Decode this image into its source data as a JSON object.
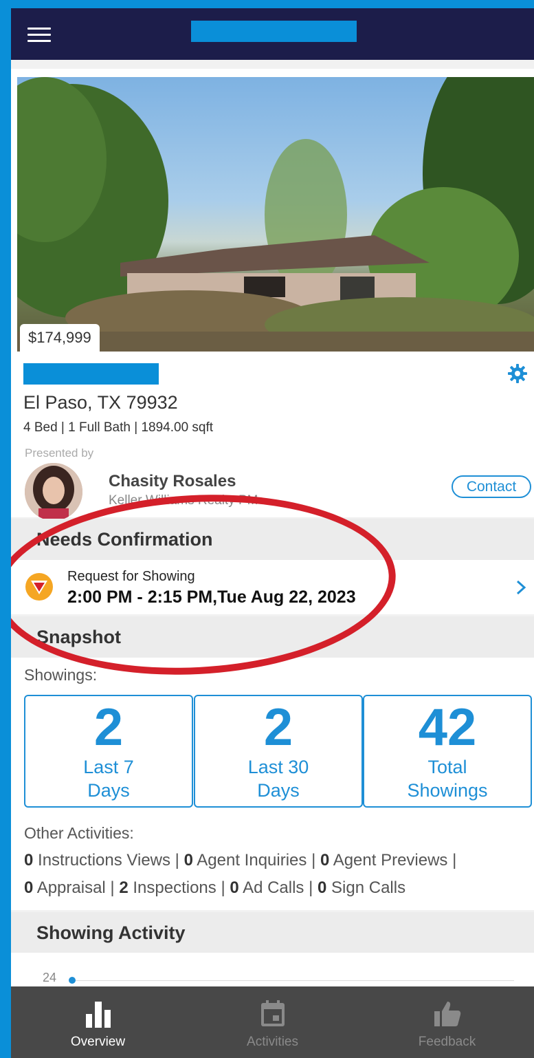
{
  "header": {
    "title_redacted": true
  },
  "listing": {
    "price": "$174,999",
    "address_redacted": true,
    "city": "El Paso, TX 79932",
    "specs": "4 Bed | 1 Full Bath | 1894.00 sqft",
    "presented_by": "Presented by",
    "agent_name": "Chasity Rosales",
    "agent_company": "Keller Williams Realty PM",
    "contact_label": "Contact"
  },
  "needs_confirmation": {
    "heading": "Needs Confirmation",
    "request_label": "Request for Showing",
    "request_time": "2:00 PM - 2:15 PM,Tue Aug 22, 2023"
  },
  "snapshot": {
    "heading": "Snapshot",
    "showings_label": "Showings:",
    "stats": [
      {
        "value": "2",
        "label_line1": "Last 7",
        "label_line2": "Days"
      },
      {
        "value": "2",
        "label_line1": "Last 30",
        "label_line2": "Days"
      },
      {
        "value": "42",
        "label_line1": "Total",
        "label_line2": "Showings"
      }
    ],
    "other_label": "Other Activities:",
    "other_activities": [
      {
        "count": "0",
        "name": "Instructions Views"
      },
      {
        "count": "0",
        "name": "Agent Inquiries"
      },
      {
        "count": "0",
        "name": "Agent Previews"
      },
      {
        "count": "0",
        "name": "Appraisal"
      },
      {
        "count": "2",
        "name": "Inspections"
      },
      {
        "count": "0",
        "name": "Ad Calls"
      },
      {
        "count": "0",
        "name": "Sign Calls"
      }
    ]
  },
  "showing_activity": {
    "heading": "Showing Activity",
    "y_tick": "24"
  },
  "bottom_nav": {
    "items": [
      {
        "label": "Overview",
        "icon": "bar-chart-icon",
        "active": true
      },
      {
        "label": "Activities",
        "icon": "calendar-icon",
        "active": false
      },
      {
        "label": "Feedback",
        "icon": "thumbs-up-icon",
        "active": false
      }
    ]
  },
  "colors": {
    "frame": "#0a8fd8",
    "header": "#1c1d4a",
    "accent": "#1e8fd6",
    "annotation": "#d4202a",
    "nav": "#484848"
  }
}
